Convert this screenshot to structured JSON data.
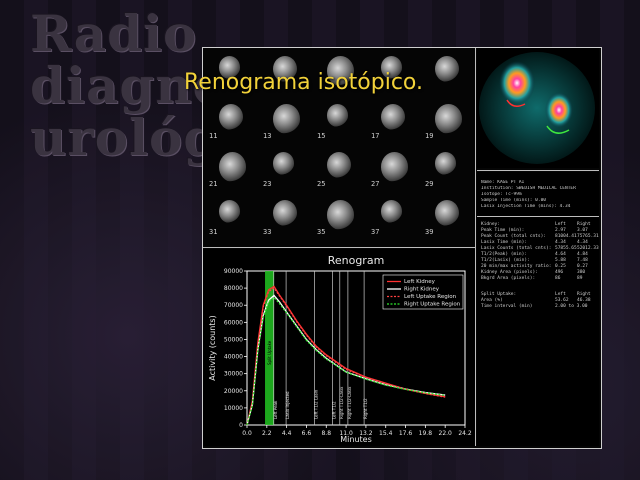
{
  "background_title_lines": [
    "Radio",
    "diagnó",
    "urológic"
  ],
  "slide_title": "Renograma isotópico.",
  "frame_numbers": [
    "11",
    "13",
    "15",
    "17",
    "19",
    "21",
    "23",
    "25",
    "27",
    "29",
    "31",
    "33",
    "35",
    "37",
    "39"
  ],
  "info": {
    "patient_lines": [
      "Name: KAGE PT AI",
      "Institution: SWEDISH MEDICAL CENTER",
      "Isotope: Tc-99m",
      "Sample Time (mins): 0.00",
      "Lasix Injection Time (mins): 4.34"
    ],
    "kidney_header": [
      "Kidney:",
      "Left",
      "Right"
    ],
    "kidney_rows": [
      [
        "Peak Time (min):",
        "2.97",
        "3.07"
      ],
      [
        "Peak Count (total cnts):",
        "81004.41",
        "75765.31"
      ],
      [
        "Lasix Time (min):",
        "4.34",
        "4.34"
      ],
      [
        "Lasix Counts (total cnts):",
        "57855.65",
        "52012.33"
      ],
      [
        "T1/2(Peak) (min):",
        "4.64",
        "4.84"
      ],
      [
        "T1/2(Lasix) (min):",
        "5.88",
        "7.48"
      ],
      [
        "20 min/max activity ratio:",
        "0.25",
        "0.27"
      ],
      [
        "Kidney Area (pixels):",
        "496",
        "380"
      ],
      [
        "Bkgrd Area (pixels):",
        "86",
        "89"
      ]
    ],
    "split_header": [
      "Split Uptake:",
      "Left",
      "Right"
    ],
    "split_rows": [
      [
        "Area (%)",
        "53.62",
        "46.38"
      ],
      [
        "Time interval (min)",
        "2.00 to 3.00",
        ""
      ]
    ]
  },
  "chart_data": {
    "type": "line",
    "title": "Renogram",
    "xlabel": "Minutes",
    "ylabel": "Activity (counts)",
    "xlim": [
      0,
      24.2
    ],
    "ylim": [
      0,
      90000
    ],
    "x_ticks": [
      "0.0",
      "2.2",
      "4.4",
      "6.6",
      "8.8",
      "11.0",
      "13.2",
      "15.4",
      "17.6",
      "19.8",
      "22.0",
      "24.2"
    ],
    "y_ticks": [
      "0",
      "10000",
      "20000",
      "30000",
      "40000",
      "50000",
      "60000",
      "70000",
      "80000",
      "90000"
    ],
    "legend_position": "top-right",
    "colors": {
      "left": "#ff3030",
      "right": "#ffffff",
      "left_upper": "#ff4040",
      "right_uptake": "#2ee62e",
      "band": "#22c422"
    },
    "series": [
      {
        "name": "Left Kidney",
        "color": "#ff3030",
        "x": [
          0.0,
          0.6,
          1.2,
          1.8,
          2.4,
          3.0,
          3.6,
          4.4,
          5.5,
          6.6,
          7.7,
          8.8,
          9.9,
          11.0,
          13.2,
          15.4,
          17.6,
          19.8,
          22.0
        ],
        "y": [
          0,
          14000,
          48000,
          70000,
          79000,
          81000,
          76000,
          70000,
          61000,
          53000,
          46000,
          41000,
          37000,
          33000,
          28000,
          24500,
          21000,
          18500,
          16500
        ]
      },
      {
        "name": "Right Kidney",
        "color": "#ffffff",
        "x": [
          0.0,
          0.6,
          1.2,
          1.8,
          2.4,
          3.0,
          3.6,
          4.4,
          5.5,
          6.6,
          7.7,
          8.8,
          9.9,
          11.0,
          13.2,
          15.4,
          17.6,
          19.8,
          22.0
        ],
        "y": [
          0,
          12000,
          44000,
          64000,
          73000,
          75700,
          72000,
          66000,
          58000,
          50000,
          44000,
          39000,
          35000,
          31000,
          27000,
          23500,
          21000,
          19000,
          17500
        ]
      },
      {
        "name": "Left Uptake Region",
        "color": "#ff4040",
        "dashed": true,
        "x": [
          0.0,
          0.6,
          1.2,
          1.8,
          2.4,
          3.0,
          3.6,
          4.4,
          5.5,
          6.6,
          7.7,
          8.8,
          9.9,
          11.0,
          13.2,
          15.4,
          17.6,
          19.8,
          22.0
        ],
        "y": [
          0,
          13500,
          47000,
          69000,
          78000,
          80000,
          75500,
          69500,
          60500,
          52500,
          45500,
          40500,
          36500,
          32500,
          27800,
          24200,
          20900,
          18400,
          16300
        ]
      },
      {
        "name": "Right Uptake Region",
        "color": "#2ee62e",
        "dashed": true,
        "x": [
          0.0,
          0.6,
          1.2,
          1.8,
          2.4,
          3.0,
          3.6,
          4.4,
          5.5,
          6.6,
          7.7,
          8.8,
          9.9,
          11.0,
          13.2,
          15.4,
          17.6,
          19.8,
          22.0
        ],
        "y": [
          0,
          11500,
          43000,
          63000,
          72000,
          74500,
          71000,
          65500,
          57500,
          49500,
          43500,
          38500,
          34800,
          30800,
          26800,
          23300,
          20800,
          18800,
          17300
        ]
      }
    ],
    "band": {
      "x_start": 2.0,
      "x_end": 3.0,
      "label": "Split Uptake"
    },
    "vlines": [
      {
        "x": 2.97,
        "label": "Left Peak"
      },
      {
        "x": 4.34,
        "label": "Lasix Injected"
      },
      {
        "x": 7.48,
        "label": "Left T1/2 Lasix"
      },
      {
        "x": 9.5,
        "label": "Left T1/2"
      },
      {
        "x": 10.3,
        "label": "Right T1/2-Lasix"
      },
      {
        "x": 11.2,
        "label": "Right T1/2-Lasix"
      },
      {
        "x": 13.0,
        "label": "Right T1/2"
      }
    ]
  }
}
